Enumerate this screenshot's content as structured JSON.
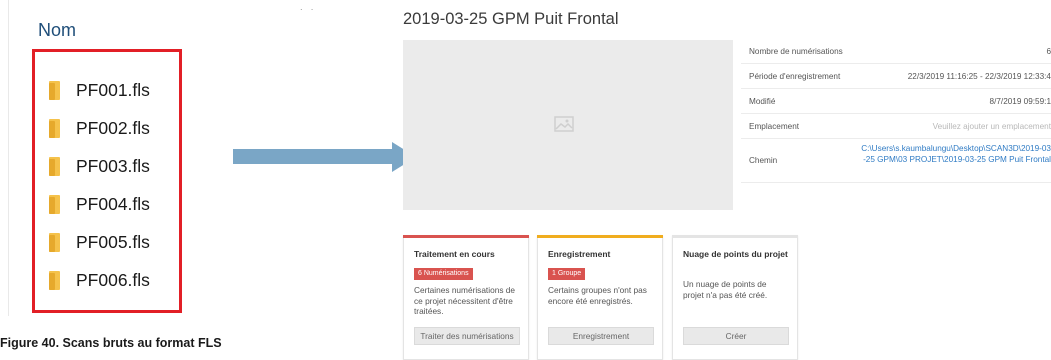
{
  "explorer": {
    "column_header": "Nom",
    "files": [
      "PF001.fls",
      "PF002.fls",
      "PF003.fls",
      "PF004.fls",
      "PF005.fls",
      "PF006.fls"
    ],
    "highlight_color": "#e21f26"
  },
  "caption": "Figure 40. Scans bruts au format FLS",
  "project": {
    "title": "2019-03-25 GPM Puit Frontal",
    "info": [
      {
        "label": "Nombre de numérisations",
        "value": "6"
      },
      {
        "label": "Période d'enregistrement",
        "value": "22/3/2019 11:16:25 - 22/3/2019 12:33:4"
      },
      {
        "label": "Modifié",
        "value": "8/7/2019 09:59:1"
      },
      {
        "label": "Emplacement",
        "value": "Veuillez ajouter un emplacement"
      },
      {
        "label": "Chemin",
        "value": "C:\\Users\\s.kaumbalungu\\Desktop\\SCAN3D\\2019-03-25 GPM\\03 PROJET\\2019-03-25 GPM Puit Frontal"
      }
    ],
    "cards": [
      {
        "title": "Traitement en cours",
        "badge": "6 Numérisations",
        "desc": "Certaines numérisations de ce projet nécessitent d'être traitées.",
        "button": "Traiter des numérisations",
        "accent": "#d9534f"
      },
      {
        "title": "Enregistrement",
        "badge": "1 Groupe",
        "desc": "Certains groupes n'ont pas encore été enregistrés.",
        "button": "Enregistrement",
        "accent": "#f0ad1e"
      },
      {
        "title": "Nuage de points du projet",
        "badge": "",
        "desc": "Un nuage de points de projet n'a pas été créé.",
        "button": "Créer",
        "accent": "#e4e4e4"
      }
    ]
  },
  "icons": {
    "folder": "folder-icon",
    "image_placeholder": "image-icon",
    "arrow": "right-arrow-icon"
  }
}
